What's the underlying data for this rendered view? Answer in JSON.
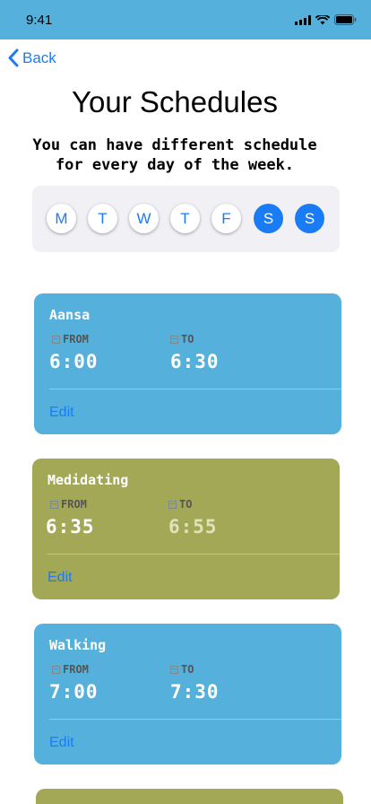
{
  "status": {
    "time": "9:41"
  },
  "nav": {
    "back_label": "Back"
  },
  "title": "Your Schedules",
  "subtitle_line1": "You can have different schedule",
  "subtitle_line2": "for every day of the week.",
  "days": [
    {
      "label": "M",
      "selected": false
    },
    {
      "label": "T",
      "selected": false
    },
    {
      "label": "W",
      "selected": false
    },
    {
      "label": "T",
      "selected": false
    },
    {
      "label": "F",
      "selected": false
    },
    {
      "label": "S",
      "selected": true
    },
    {
      "label": "S",
      "selected": true
    }
  ],
  "labels": {
    "from": "FROM",
    "to": "TO",
    "edit": "Edit"
  },
  "schedules": [
    {
      "name": "Aansa",
      "from": "6:00",
      "to": "6:30",
      "color": "#55b0db"
    },
    {
      "name": "Medidating",
      "from": "6:35",
      "to": "6:55",
      "color": "#a3a857"
    },
    {
      "name": "Walking",
      "from": "7:00",
      "to": "7:30",
      "color": "#55b0db"
    }
  ],
  "colors": {
    "accent": "#1a7cf5",
    "status_bar": "#55b0db",
    "card_blue": "#55b0db",
    "card_olive": "#a3a857"
  }
}
